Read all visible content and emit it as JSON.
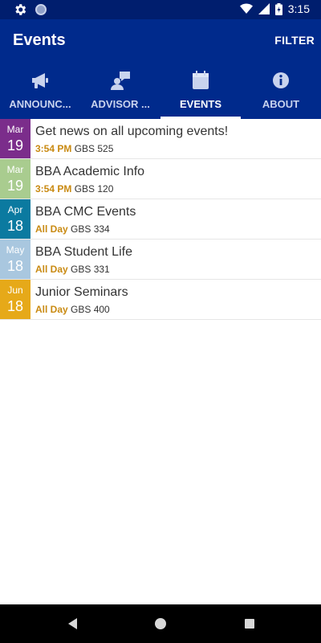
{
  "status_bar": {
    "time": "3:15",
    "icons": [
      "gear-icon",
      "circle-icon",
      "wifi-icon",
      "signal-icon",
      "battery-icon"
    ]
  },
  "app_bar": {
    "title": "Events",
    "filter_label": "FILTER",
    "background": "#002a8c"
  },
  "tabs": [
    {
      "label": "ANNOUNC...",
      "icon": "megaphone-icon",
      "active": false
    },
    {
      "label": "ADVISOR ...",
      "icon": "advisor-icon",
      "active": false
    },
    {
      "label": "EVENTS",
      "icon": "calendar-icon",
      "active": true
    },
    {
      "label": "ABOUT",
      "icon": "info-icon",
      "active": false
    }
  ],
  "events": [
    {
      "month": "Mar",
      "day": "19",
      "color": "#7b2d8b",
      "title": "Get news on all upcoming events!",
      "time": "3:54 PM",
      "location": "GBS 525"
    },
    {
      "month": "Mar",
      "day": "19",
      "color": "#a9cc8f",
      "title": "BBA Academic Info",
      "time": "3:54 PM",
      "location": "GBS 120"
    },
    {
      "month": "Apr",
      "day": "18",
      "color": "#0b7aa0",
      "title": "BBA CMC Events",
      "time": "All Day",
      "location": "GBS 334"
    },
    {
      "month": "May",
      "day": "18",
      "color": "#a9c7df",
      "title": "BBA Student Life",
      "time": "All Day",
      "location": "GBS 331"
    },
    {
      "month": "Jun",
      "day": "18",
      "color": "#e6a919",
      "title": "Junior Seminars",
      "time": "All Day",
      "location": "GBS 400"
    }
  ]
}
